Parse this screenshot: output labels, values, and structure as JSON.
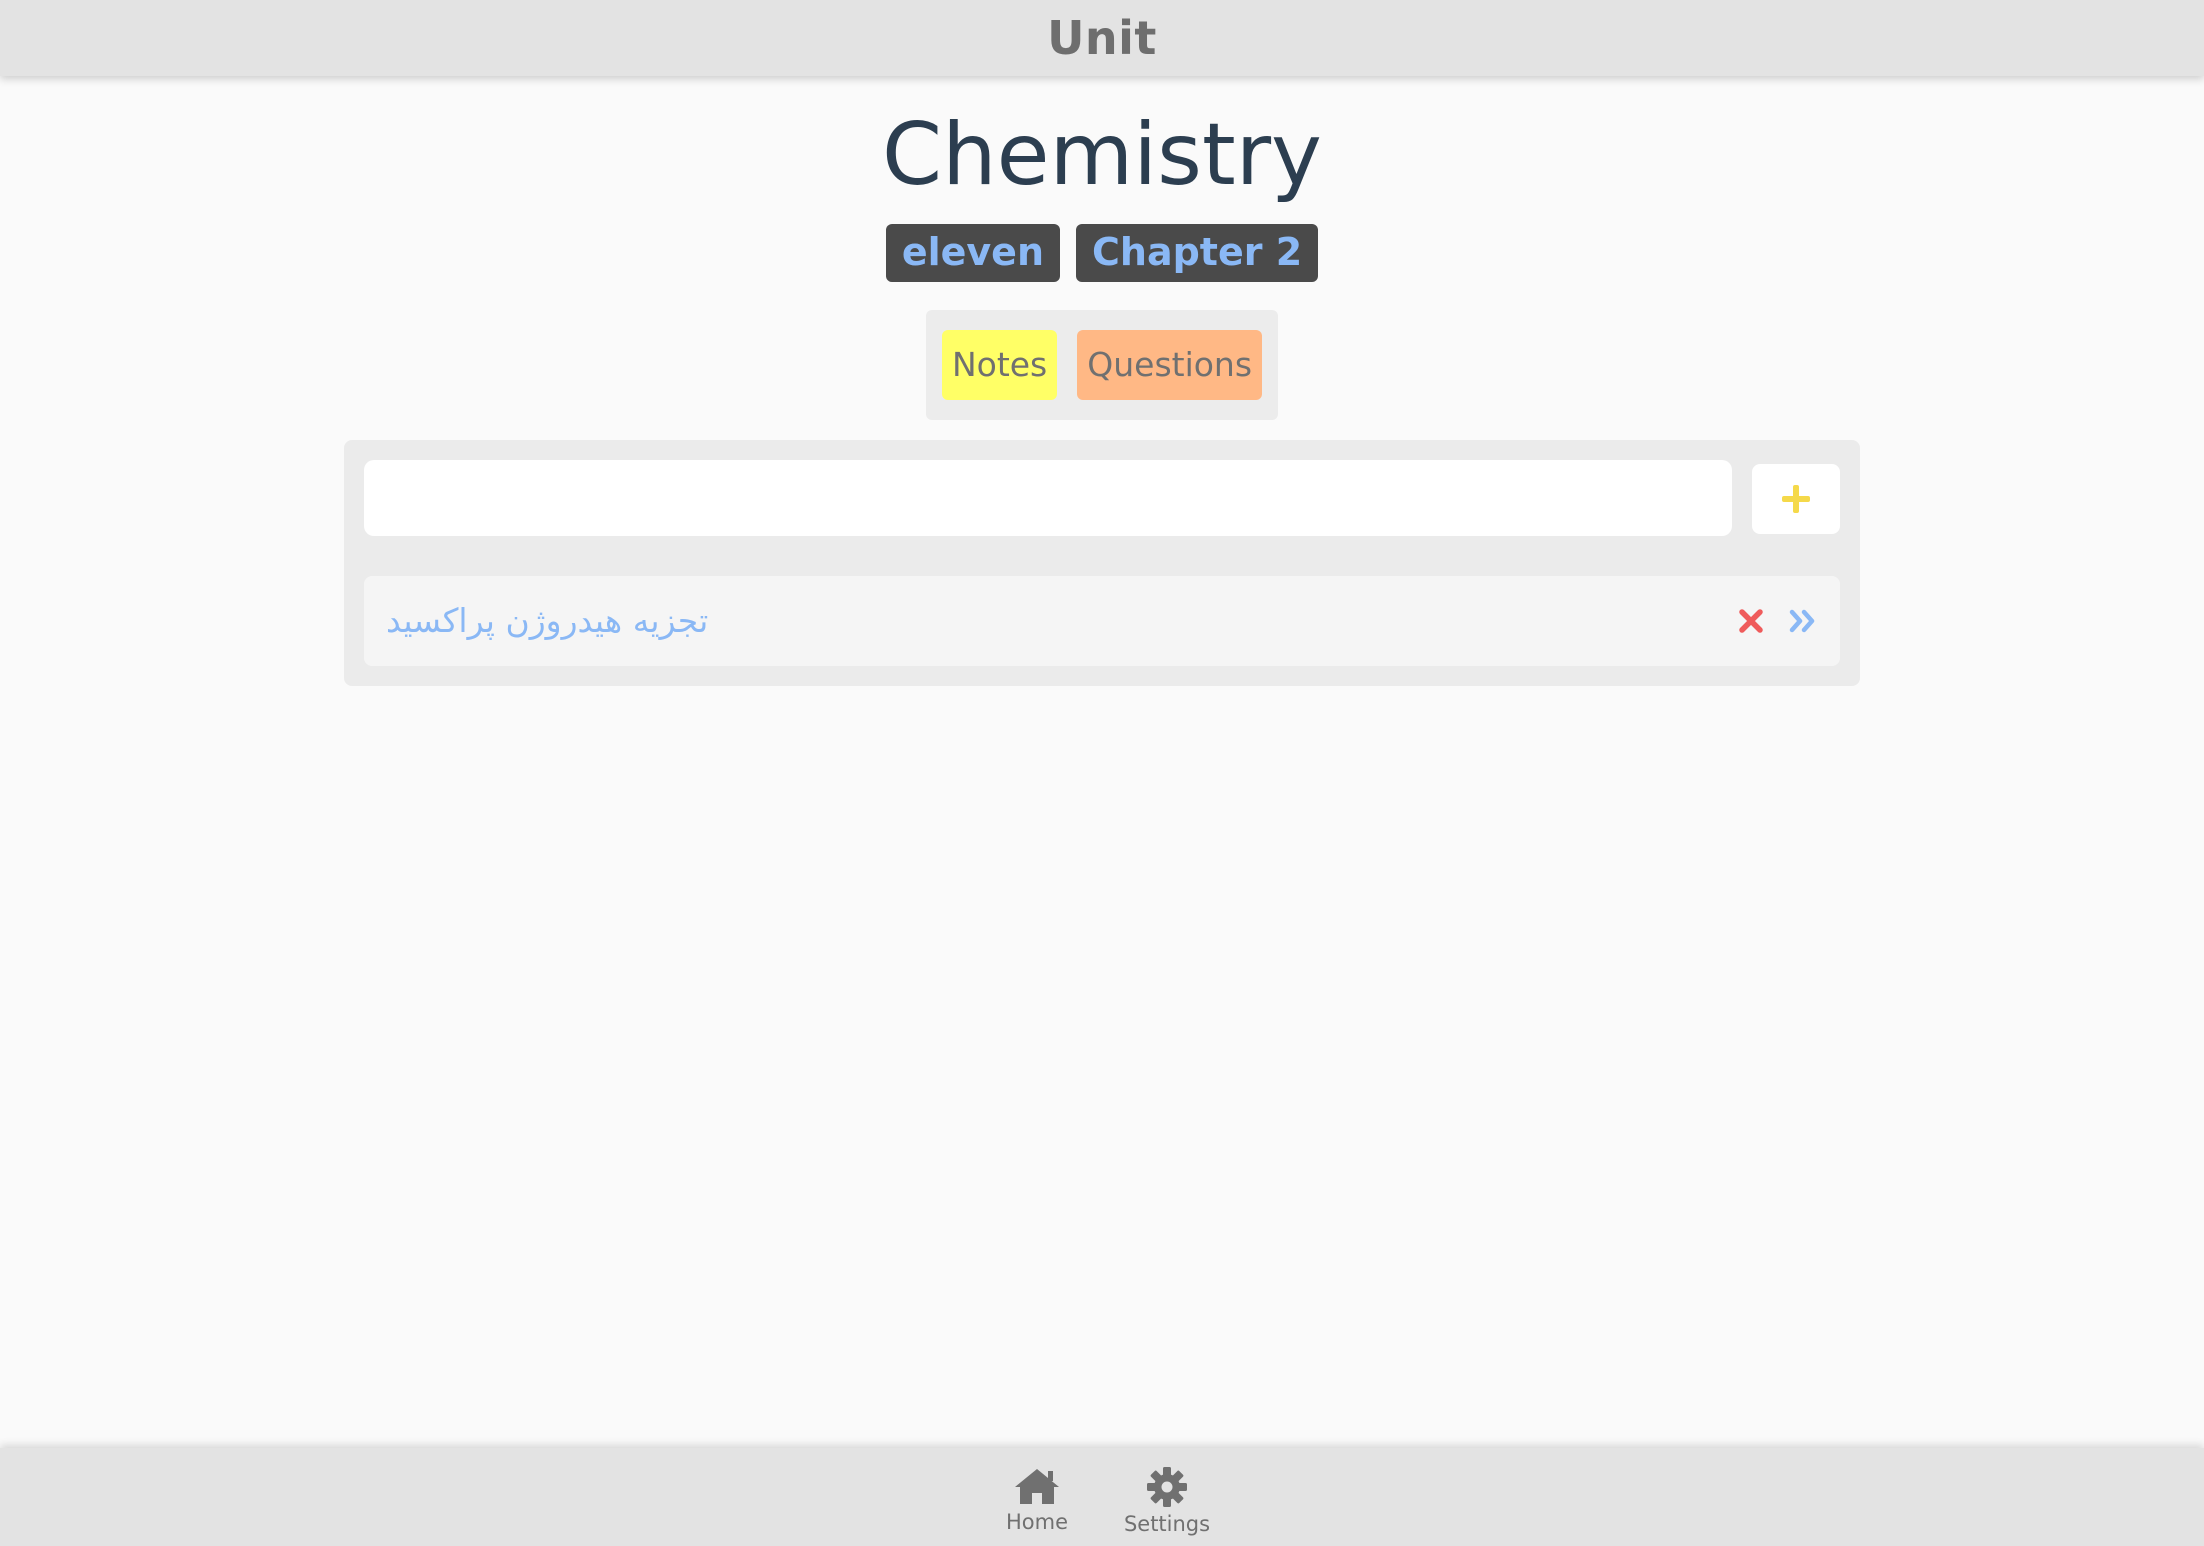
{
  "header": {
    "title": "Unit"
  },
  "subject": {
    "title": "Chemistry"
  },
  "badges": {
    "grade": "eleven",
    "chapter": "Chapter 2"
  },
  "tabs": {
    "notes": "Notes",
    "questions": "Questions"
  },
  "entry": {
    "value": "",
    "placeholder": ""
  },
  "list": {
    "items": [
      {
        "label": "تجزیه هیدروژن پراکسید"
      }
    ]
  },
  "bottom_nav": {
    "home": "Home",
    "settings": "Settings"
  },
  "icons": {
    "add": "plus-icon",
    "delete": "close-icon",
    "open": "double-chevron-right-icon",
    "home": "home-icon",
    "settings": "gear-icon"
  },
  "colors": {
    "badge_bg": "#4a4a4a",
    "badge_text": "#8ab8f5",
    "notes_tab": "#ffff66",
    "questions_tab": "#ffb885",
    "add_icon": "#f5d94a",
    "delete_icon": "#ef5b5b",
    "open_icon": "#8ab8f5"
  }
}
